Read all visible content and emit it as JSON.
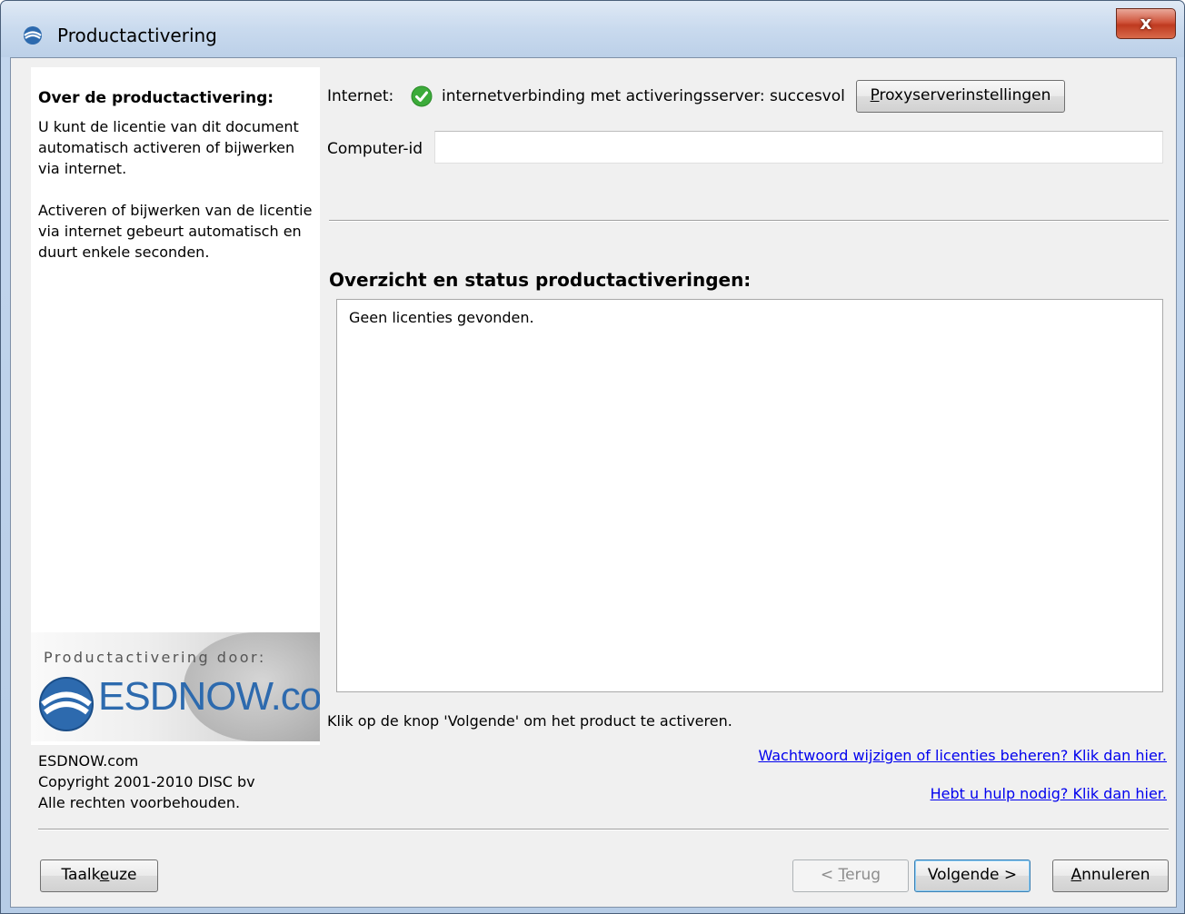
{
  "window": {
    "title": "Productactivering",
    "close_label": "x"
  },
  "sidebar": {
    "heading": "Over de productactivering:",
    "para1": "U kunt de licentie van dit document automatisch activeren of bijwerken via internet.",
    "para2": "Activeren of bijwerken van de licentie via internet gebeurt automatisch en duurt enkele seconden.",
    "logo_caption": "Productactivering door:",
    "logo_text": "ESDNOW.com",
    "footer_line1": "ESDNOW.com",
    "footer_line2": "Copyright 2001-2010 DISC bv",
    "footer_line3": "Alle rechten voorbehouden."
  },
  "internet": {
    "label": "Internet:",
    "status": "internetverbinding met activeringsserver: succesvol",
    "proxy_button_mnemonic": "P",
    "proxy_button_rest": "roxyserverinstellingen"
  },
  "computer_id": {
    "label": "Computer-id",
    "value": ""
  },
  "overview": {
    "title": "Overzicht en status productactiveringen:",
    "status_text": "Geen licenties gevonden."
  },
  "hint": "Klik op de knop 'Volgende' om het product te activeren.",
  "links": {
    "manage": "Wachtwoord wijzigen of licenties beheren? Klik dan hier.",
    "help": "Hebt u hulp nodig? Klik dan hier."
  },
  "buttons": {
    "language_pre": "Taalk",
    "language_mnemonic": "e",
    "language_post": "uze",
    "back_pre": "< ",
    "back_mnemonic": "T",
    "back_post": "erug",
    "next": "Volgende >",
    "cancel_mnemonic": "A",
    "cancel_post": "nnuleren"
  },
  "colors": {
    "client_bg": "#f0f0f0",
    "link": "#0000ee",
    "check": "#3cab3a",
    "logo_blue": "#2d6aae"
  }
}
